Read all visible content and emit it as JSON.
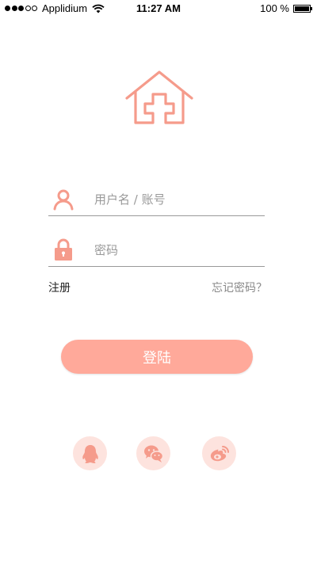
{
  "status_bar": {
    "carrier": "Applidium",
    "time": "11:27 AM",
    "battery_text": "100 %",
    "signal_icon": "signal-dots-icon",
    "wifi_icon": "wifi-icon",
    "battery_icon": "battery-icon"
  },
  "logo": {
    "icon": "house-medical-cross-icon"
  },
  "form": {
    "username": {
      "icon": "user-icon",
      "value": "",
      "placeholder": "用户名 / 账号"
    },
    "password": {
      "icon": "lock-icon",
      "value": "",
      "placeholder": "密码"
    },
    "register_label": "注册",
    "forgot_label": "忘记密码？",
    "login_label": "登陆"
  },
  "social": {
    "items": [
      {
        "name": "qq",
        "icon": "qq-penguin-icon"
      },
      {
        "name": "wechat",
        "icon": "wechat-icon"
      },
      {
        "name": "weibo",
        "icon": "weibo-icon"
      }
    ]
  },
  "colors": {
    "accent": "#ffa99a",
    "accent_light": "#fde3de",
    "icon": "#f59b8b"
  }
}
